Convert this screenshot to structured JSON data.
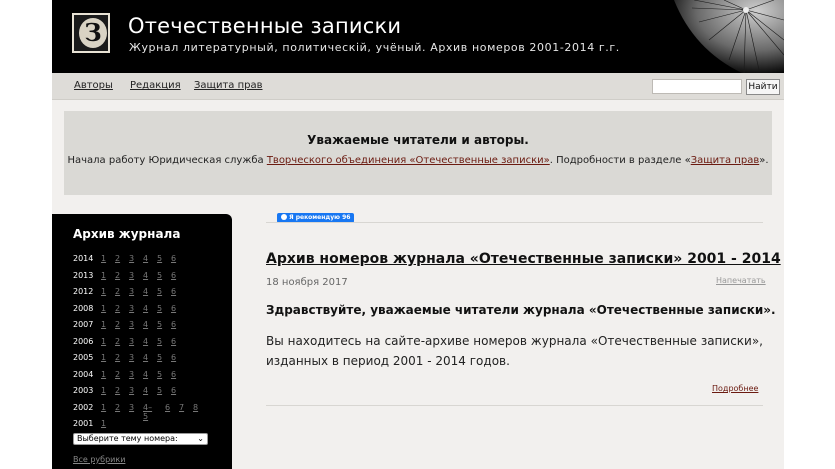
{
  "header": {
    "logo_letter": "З",
    "title": "Отечественные записки",
    "subtitle": "Журнал литературный, политическій, учёный. Архив номеров 2001-2014 г.г."
  },
  "nav": {
    "items": [
      "Авторы",
      "Редакция",
      "Защита прав"
    ],
    "search_button": "Найти"
  },
  "notice": {
    "title": "Уважаемые читатели и авторы.",
    "text_before": "Начала работу Юридическая служба ",
    "link1": "Творческого объединения «Отечественные записки»",
    "text_middle": ". Подробности в разделе «",
    "link2": "Защита прав",
    "text_after": "»."
  },
  "sidebar": {
    "title": "Архив журнала",
    "archive": [
      {
        "year": "2014",
        "issues": [
          "1",
          "2",
          "3",
          "4",
          "5",
          "6"
        ]
      },
      {
        "year": "2013",
        "issues": [
          "1",
          "2",
          "3",
          "4",
          "5",
          "6"
        ]
      },
      {
        "year": "2012",
        "issues": [
          "1",
          "2",
          "3",
          "4",
          "5",
          "6"
        ]
      },
      {
        "year": "2008",
        "issues": [
          "1",
          "2",
          "3",
          "4",
          "5",
          "6"
        ]
      },
      {
        "year": "2007",
        "issues": [
          "1",
          "2",
          "3",
          "4",
          "5",
          "6"
        ]
      },
      {
        "year": "2006",
        "issues": [
          "1",
          "2",
          "3",
          "4",
          "5",
          "6"
        ]
      },
      {
        "year": "2005",
        "issues": [
          "1",
          "2",
          "3",
          "4",
          "5",
          "6"
        ]
      },
      {
        "year": "2004",
        "issues": [
          "1",
          "2",
          "3",
          "4",
          "5",
          "6"
        ]
      },
      {
        "year": "2003",
        "issues": [
          "1",
          "2",
          "3",
          "4",
          "5",
          "6"
        ]
      },
      {
        "year": "2002",
        "issues": [
          "1",
          "2",
          "3",
          "4–5",
          "6",
          "7",
          "8"
        ]
      },
      {
        "year": "2001",
        "issues": [
          "1"
        ]
      }
    ],
    "theme_select": "Выберите тему номера:",
    "all_rubrics": "Все рубрики"
  },
  "social": {
    "fb_label": "Я рекомендую",
    "fb_count": "96"
  },
  "article": {
    "title": "Архив номеров журнала «Отечественные записки» 2001 - 2014",
    "date": "18 ноября 2017",
    "print_label": "Напечатать",
    "greeting": "Здравствуйте, уважаемые читатели журнала «Отечественные записки».",
    "body": "Вы находитесь на сайте-архиве номеров журнала «Отечественные записки», изданных в период 2001 - 2014 годов.",
    "more_label": "Подробнее"
  },
  "colors": {
    "header_bg": "#000000",
    "page_bg": "#f2f0ee",
    "notice_bg": "#dad9d5",
    "link_dark_red": "#6b1a10",
    "fb_blue": "#1877f2"
  }
}
